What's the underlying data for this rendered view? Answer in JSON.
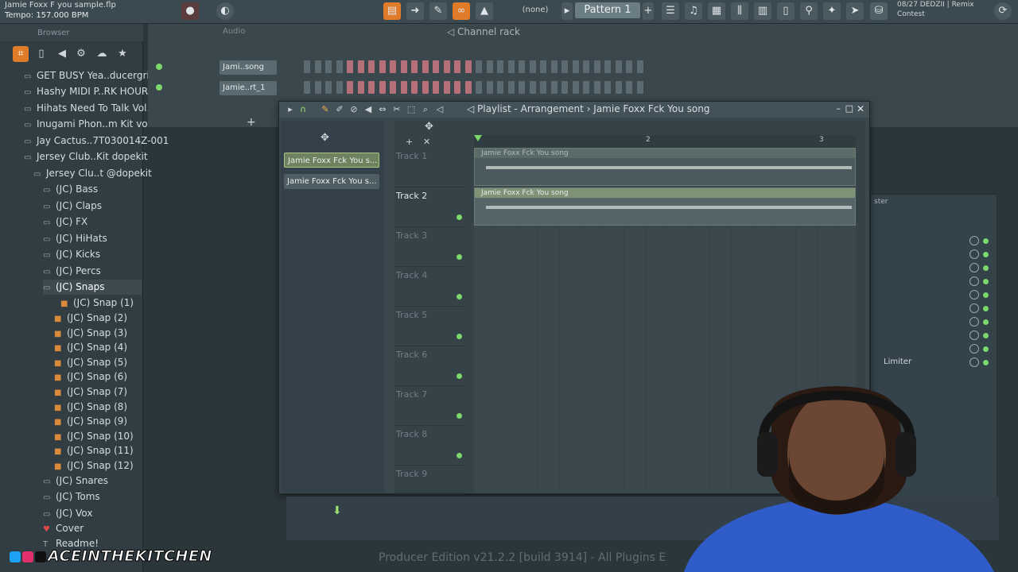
{
  "topbar": {
    "song_title": "Jamie Foxx F you sample.flp",
    "tempo": "Tempo: 157.000 BPM",
    "snap": "(none)",
    "pattern": "Pattern 1",
    "news_line1": "08/27  DEDZII | Remix",
    "news_line2": "Contest"
  },
  "browser": {
    "header": "Browser",
    "items": [
      {
        "label": "GET BUSY Yea..ducergrind)"
      },
      {
        "label": "Hashy MIDI P..RK HOURS 2"
      },
      {
        "label": "Hihats Need To Talk Vol.1"
      },
      {
        "label": "Inugami Phon..m Kit vol.1"
      },
      {
        "label": "Jay Cactus..7T030014Z-001"
      },
      {
        "label": "Jersey Club..Kit dopekit"
      },
      {
        "label": "Jersey Clu..t @dopekit"
      },
      {
        "label": "(JC) Bass"
      },
      {
        "label": "(JC) Claps"
      },
      {
        "label": "(JC) FX"
      },
      {
        "label": "(JC) HiHats"
      },
      {
        "label": "(JC) Kicks"
      },
      {
        "label": "(JC) Percs"
      },
      {
        "label": "(JC) Snaps"
      },
      {
        "label": "(JC) Snap (1)"
      },
      {
        "label": "(JC) Snap (2)"
      },
      {
        "label": "(JC) Snap (3)"
      },
      {
        "label": "(JC) Snap (4)"
      },
      {
        "label": "(JC) Snap (5)"
      },
      {
        "label": "(JC) Snap (6)"
      },
      {
        "label": "(JC) Snap (7)"
      },
      {
        "label": "(JC) Snap (8)"
      },
      {
        "label": "(JC) Snap (9)"
      },
      {
        "label": "(JC) Snap (10)"
      },
      {
        "label": "(JC) Snap (11)"
      },
      {
        "label": "(JC) Snap (12)"
      },
      {
        "label": "(JC) Snares"
      },
      {
        "label": "(JC) Toms"
      },
      {
        "label": "(JC) Vox"
      },
      {
        "label": "Cover"
      },
      {
        "label": "Readme!"
      }
    ]
  },
  "channel_rack": {
    "audio_label": "Audio",
    "title": "Channel rack",
    "channels": [
      {
        "name": "Jami..song"
      },
      {
        "name": "Jamie..rt_1"
      }
    ]
  },
  "mixer": {
    "title": "ster",
    "slot_label": "Limiter"
  },
  "playlist": {
    "title": "Playlist - Arrangement  ›  Jamie Foxx Fck You song",
    "picker_items": [
      {
        "label": "Jamie Foxx Fck You s..."
      },
      {
        "label": "Jamie Foxx Fck You s..."
      }
    ],
    "bar_numbers": [
      "2",
      "3"
    ],
    "tracks": [
      {
        "label": "Track 1",
        "clip": "Jamie Foxx Fck You song"
      },
      {
        "label": "Track 2",
        "clip": "Jamie Foxx Fck You song"
      },
      {
        "label": "Track 3"
      },
      {
        "label": "Track 4"
      },
      {
        "label": "Track 5"
      },
      {
        "label": "Track 6"
      },
      {
        "label": "Track 7"
      },
      {
        "label": "Track 8"
      },
      {
        "label": "Track 9"
      }
    ]
  },
  "status_bar": "Producer Edition v21.2.2 [build 3914] - All Plugins E",
  "overlay": {
    "brand": "ACEINTHEKITCHEN"
  },
  "colors": {
    "accent_orange": "#e07b2a",
    "led_green": "#7bd86a",
    "clip_green": "#7e9275"
  }
}
